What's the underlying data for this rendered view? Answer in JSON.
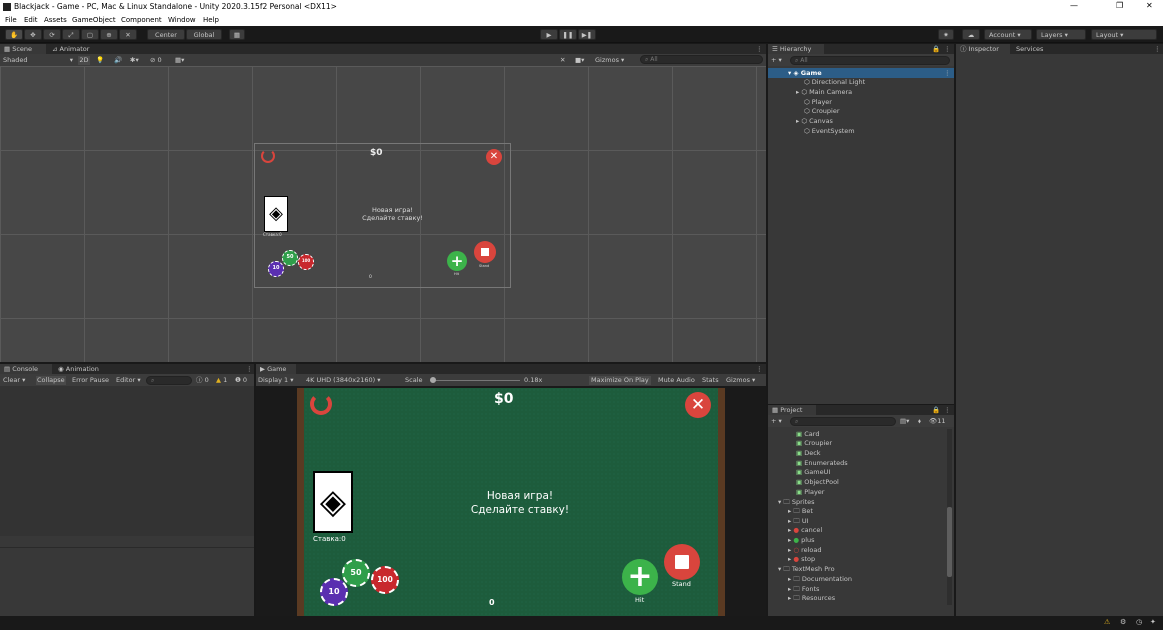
{
  "titlebar": {
    "title": "Blackjack - Game - PC, Mac & Linux Standalone - Unity 2020.3.15f2 Personal <DX11>"
  },
  "menu": [
    "File",
    "Edit",
    "Assets",
    "GameObject",
    "Component",
    "Window",
    "Help"
  ],
  "toolbar": {
    "center": "Center",
    "global": "Global",
    "account": "Account",
    "layers": "Layers",
    "layout": "Layout"
  },
  "scene": {
    "tabs": [
      "Scene",
      "Animator"
    ],
    "shading": "Shaded",
    "mode_2d": "2D",
    "gizmos": "Gizmos",
    "search_placeholder": "All",
    "money": "$0",
    "message_line1": "Новая игра!",
    "message_line2": "Сделайте ставку!",
    "bet_label": "Ставка:0",
    "chips": [
      "10",
      "50",
      "100"
    ],
    "hit": "Hit",
    "stand": "Stand",
    "bottom_value": "0"
  },
  "hierarchy": {
    "tab": "Hierarchy",
    "search_placeholder": "All",
    "root": "Game",
    "items": [
      "Directional Light",
      "Main Camera",
      "Player",
      "Croupier",
      "Canvas",
      "EventSystem"
    ]
  },
  "inspector": {
    "tabs": [
      "Inspector",
      "Services"
    ]
  },
  "console": {
    "tabs": [
      "Console",
      "Animation"
    ],
    "clear": "Clear",
    "collapse": "Collapse",
    "error_pause": "Error Pause",
    "editor": "Editor",
    "count_info": "0",
    "count_warn": "1",
    "count_error": "0"
  },
  "game": {
    "tab": "Game",
    "display": "Display 1",
    "resolution": "4K UHD (3840x2160)",
    "scale_label": "Scale",
    "scale_value": "0.18x",
    "maximize": "Maximize On Play",
    "mute": "Mute Audio",
    "stats": "Stats",
    "gizmos": "Gizmos",
    "money": "$0",
    "message_line1": "Новая игра!",
    "message_line2": "Сделайте ставку!",
    "bet_label": "Ставка:0",
    "chips": [
      "10",
      "50",
      "100"
    ],
    "hit": "Hit",
    "stand": "Stand",
    "bottom_value": "0"
  },
  "project": {
    "tab": "Project",
    "count": "11",
    "items": [
      "Card",
      "Croupier",
      "Deck",
      "Enumerateds",
      "GameUI",
      "ObjectPool",
      "Player",
      "Sprites",
      "Bet",
      "UI",
      "cancel",
      "plus",
      "reload",
      "stop",
      "TextMesh Pro",
      "Documentation",
      "Fonts",
      "Resources"
    ]
  },
  "colors": {
    "felt": "#1d5c3c",
    "red": "#d9453d",
    "green": "#3cb34a",
    "wood": "#5a3a22"
  }
}
